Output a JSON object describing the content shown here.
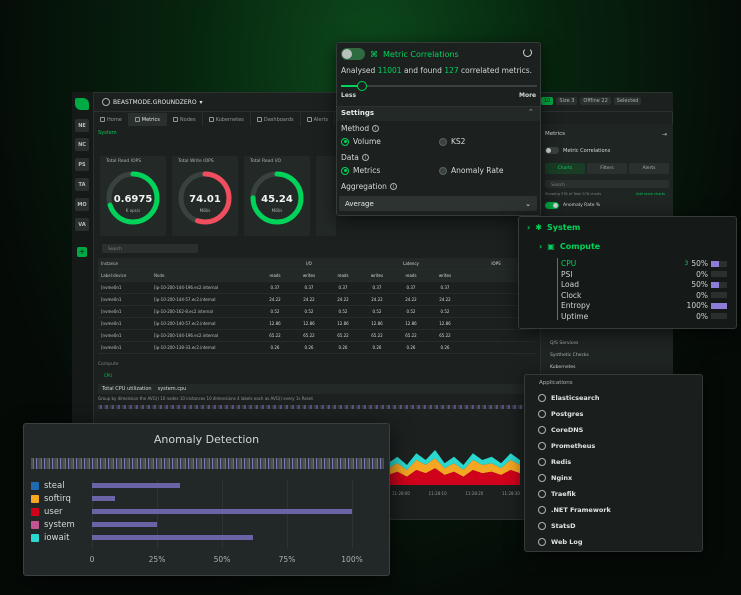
{
  "topbar": {
    "room_name": "BEASTMODE.GROUNDZERO",
    "badge_nodes_label": "Nodes",
    "badge_nodes_value": "10",
    "badge_size": "Size",
    "badge_size_value": "3",
    "badge_offline": "Offline",
    "badge_offline_value": "22",
    "badge_selected": "Selected"
  },
  "spaces": [
    "NE",
    "NC",
    "PS",
    "TA",
    "MO",
    "VA"
  ],
  "tabs": [
    "Home",
    "Metrics",
    "Nodes",
    "Kubernetes",
    "Dashboards",
    "Alerts"
  ],
  "system_link": "System",
  "gauges": [
    {
      "title": "Total Read IOPS",
      "value": "0.6975",
      "unit": "K ops/s",
      "fraction": 0.7
    },
    {
      "title": "Total Write IOPS",
      "value": "74.01",
      "unit": "MiB/s",
      "fraction": 0.55
    },
    {
      "title": "Total Read I/O",
      "value": "45.24",
      "unit": "MiB/s",
      "fraction": 0.75
    }
  ],
  "table": {
    "search_placeholder": "Search",
    "group_headers": [
      "Instance",
      "I/O",
      "Latency",
      "IOPS"
    ],
    "columns": [
      "Label:device",
      "Node",
      "reads",
      "writes",
      "reads",
      "writes",
      "reads",
      "writes"
    ],
    "rows": [
      [
        "[nvme0n1",
        "[ip-10-200-144-196.ec2.internal",
        "0.37",
        "0.37",
        "0.37",
        "0.37",
        "0.37",
        "0.37"
      ],
      [
        "[nvme0n1",
        "[ip-10-200-144-57.ec2.internal",
        "24.22",
        "24.22",
        "24.22",
        "24.22",
        "24.22",
        "24.22"
      ],
      [
        "[nvme0n1",
        "[ip-10-200-162-8.ec2.internal",
        "0.52",
        "0.52",
        "0.52",
        "0.52",
        "0.52",
        "0.52"
      ],
      [
        "[nvme0n1",
        "[ip-10-200-140-57.ec2.internal",
        "12.86",
        "12.86",
        "12.86",
        "12.86",
        "12.86",
        "12.86"
      ],
      [
        "[nvme0n1",
        "[ip-10-200-144-196.ec2.internal",
        "65.22",
        "65.22",
        "65.22",
        "65.22",
        "65.22",
        "65.22"
      ],
      [
        "[nvme0n1",
        "[ip-10-200-138-33.ec2.internal",
        "0.26",
        "0.26",
        "0.26",
        "0.26",
        "0.26",
        "0.26"
      ]
    ]
  },
  "compute_header": "Compute",
  "cpu_sub": "CPU",
  "chart_bar": {
    "title": "Total CPU utilization",
    "context": "system.cpu",
    "groupby": "Group by dimension  the AVG()  10 nodes  10 instances  10 dimensions  4 labels  each as AVG()  every 1s  Reset"
  },
  "chart_times": [
    "11:28:00",
    "11:28:10",
    "11:28:20",
    "11:28:30"
  ],
  "right_panel": {
    "title": "Metrics",
    "metric_correlations": "Metric Correlations",
    "tabs": [
      "Charts",
      "Filters",
      "Alerts"
    ],
    "search_placeholder": "Search",
    "showing": "Showing 578 of Total 578 charts",
    "add_more": "Add more charts",
    "anomaly_rate": "Anomaly Rate %",
    "list": [
      "Q/S Services",
      "Synthetic Checks",
      "Kubernetes"
    ]
  },
  "mc_popup": {
    "title": "Metric Correlations",
    "analysed_prefix": "Analysed",
    "analysed_count": "11001",
    "analysed_mid": "and found",
    "found_count": "127",
    "analysed_suffix": "correlated metrics.",
    "slider_fraction": 0.12,
    "less": "Less",
    "more": "More",
    "settings": "Settings",
    "method_label": "Method",
    "method_options": [
      "Volume",
      "KS2"
    ],
    "method_selected": "Volume",
    "data_label": "Data",
    "data_options": [
      "Metrics",
      "Anomaly Rate"
    ],
    "data_selected": "Metrics",
    "aggregation_label": "Aggregation",
    "aggregation_value": "Average"
  },
  "system_tree": {
    "system": "System",
    "compute": "Compute",
    "cpu_badge": "3",
    "leaves": [
      {
        "name": "CPU",
        "value": "50%",
        "fraction": 0.5
      },
      {
        "name": "PSI",
        "value": "0%",
        "fraction": 0
      },
      {
        "name": "Load",
        "value": "50%",
        "fraction": 0.5
      },
      {
        "name": "Clock",
        "value": "0%",
        "fraction": 0
      },
      {
        "name": "Entropy",
        "value": "100%",
        "fraction": 1
      },
      {
        "name": "Uptime",
        "value": "0%",
        "fraction": 0
      }
    ]
  },
  "applications": {
    "title": "Applications",
    "items": [
      "Elasticsearch",
      "Postgres",
      "CoreDNS",
      "Prometheus",
      "Redis",
      "Nginx",
      "Traefik",
      ".NET Framework",
      "StatsD",
      "Web Log"
    ]
  },
  "anomaly": {
    "title": "Anomaly Detection",
    "colors": {
      "steal": "#1f6bb0",
      "softirq": "#f5a623",
      "user": "#d0021b",
      "system": "#c2548f",
      "iowait": "#2ad8d0"
    },
    "chart_data": {
      "type": "bar",
      "categories": [
        "steal",
        "softirq",
        "user",
        "system",
        "iowait"
      ],
      "values": [
        34,
        9,
        100,
        25,
        62
      ],
      "xlim": [
        0,
        100
      ],
      "xticks": [
        "0",
        "25%",
        "50%",
        "75%",
        "100%"
      ]
    }
  },
  "stack_chart": {
    "chart_data": {
      "type": "area",
      "series": [
        {
          "values": [
            6,
            8,
            5,
            9,
            7,
            10,
            6,
            8,
            5,
            9,
            7,
            8,
            6,
            9,
            7
          ]
        },
        {
          "values": [
            4,
            5,
            4,
            6,
            5,
            6,
            4,
            5,
            4,
            6,
            5,
            5,
            4,
            6,
            5
          ]
        },
        {
          "values": [
            3,
            4,
            3,
            4,
            3,
            5,
            3,
            4,
            3,
            4,
            3,
            4,
            3,
            4,
            3
          ]
        }
      ],
      "colors": [
        "#d0021b",
        "#f5a623",
        "#2ad8d0"
      ]
    }
  }
}
